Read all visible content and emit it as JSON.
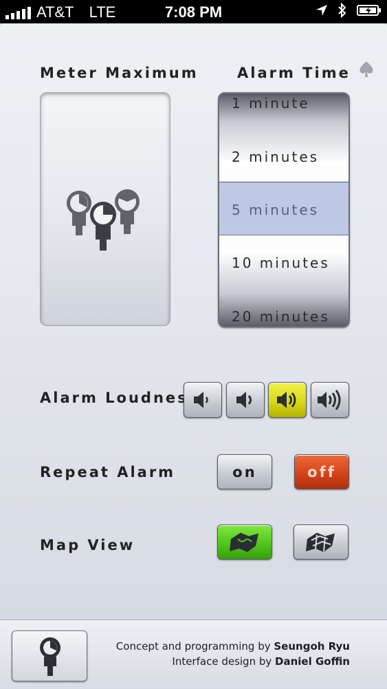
{
  "status_bar": {
    "carrier": "AT&T",
    "network": "LTE",
    "time": "7:08 PM"
  },
  "meter": {
    "label": "Meter Maximum"
  },
  "alarm_time": {
    "label": "Alarm Time",
    "options": [
      "1 minute",
      "2 minutes",
      "5 minutes",
      "10 minutes",
      "20 minutes"
    ],
    "selected": "5 minutes"
  },
  "loudness": {
    "label": "Alarm Loudness",
    "levels": [
      "speaker-1-icon",
      "speaker-2-icon",
      "speaker-3-icon",
      "speaker-4-icon"
    ],
    "selected_index": 2,
    "selected_color": "#e6e623"
  },
  "repeat": {
    "label": "Repeat Alarm",
    "on_label": "on",
    "off_label": "off",
    "selected": "off",
    "selected_color": "#d4441c"
  },
  "map_view": {
    "label": "Map View",
    "options": [
      "map-solid-icon",
      "map-outline-icon"
    ],
    "selected_index": 0,
    "selected_color": "#52c51e"
  },
  "footer": {
    "concept_prefix": "Concept and programming by",
    "concept_name": "Seungoh Ryu",
    "design_prefix": "Interface design by",
    "design_name": "Daniel Goffin"
  }
}
